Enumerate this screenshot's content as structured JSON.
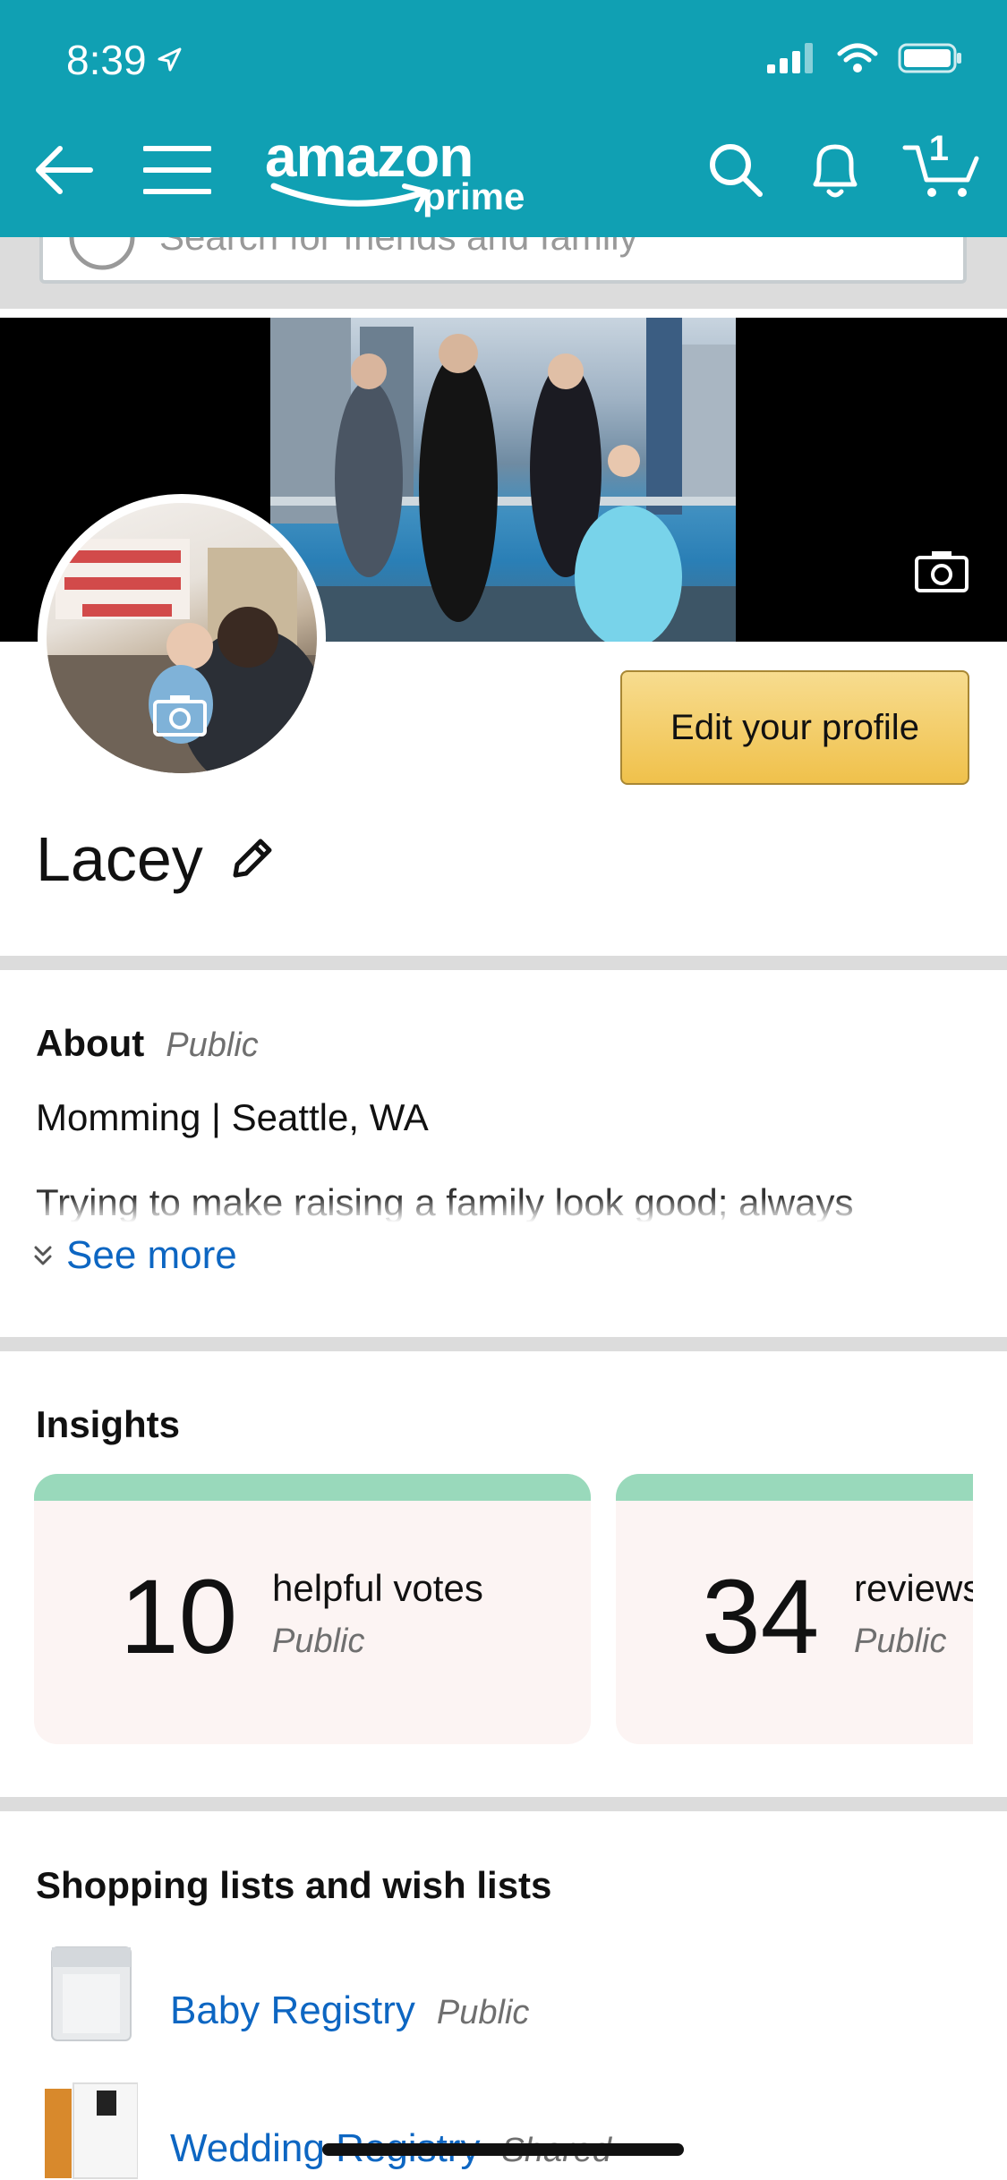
{
  "status_bar": {
    "time": "8:39"
  },
  "header": {
    "logo_word": "amazon",
    "logo_sub": "prime",
    "cart_count": "1",
    "icons": [
      "back-arrow-icon",
      "menu-icon",
      "search-icon",
      "bell-icon",
      "cart-icon"
    ]
  },
  "search": {
    "placeholder": "Search for friends and family"
  },
  "profile": {
    "name": "Lacey",
    "edit_button": "Edit your profile"
  },
  "about": {
    "title": "About",
    "visibility": "Public",
    "headline": "Momming | Seattle, WA",
    "description": "Trying to make raising a family look good; always",
    "see_more": "See more"
  },
  "insights": {
    "title": "Insights",
    "cards": [
      {
        "value": "10",
        "label": "helpful votes",
        "visibility": "Public"
      },
      {
        "value": "34",
        "label": "reviews",
        "visibility": "Public"
      }
    ]
  },
  "lists": {
    "title": "Shopping lists and wish lists",
    "items": [
      {
        "label": "Baby Registry",
        "visibility": "Public"
      },
      {
        "label": "Wedding Registry",
        "visibility": "Shared"
      }
    ]
  },
  "colors": {
    "header": "#10a0b3",
    "button": "#f0c14b",
    "link": "#0d66c2",
    "card_accent": "#99d9bb"
  }
}
